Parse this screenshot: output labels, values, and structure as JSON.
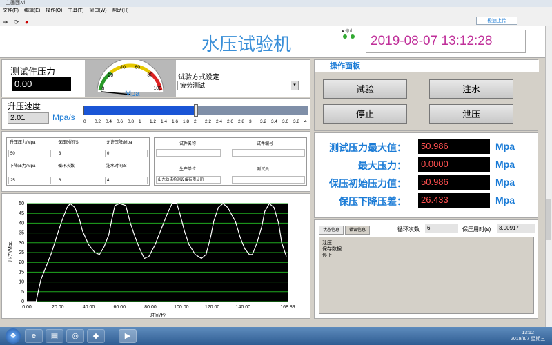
{
  "window": {
    "title": "主画面.vi"
  },
  "menu": [
    "文件(F)",
    "编辑(E)",
    "操作(O)",
    "工具(T)",
    "窗口(W)",
    "帮助(H)"
  ],
  "upload_label": "极速上传",
  "header": {
    "title": "水压试验机",
    "datetime": "2019-08-07 13:12:28",
    "light_label": "● 停止"
  },
  "pressure": {
    "label": "测试件压力",
    "value": "0.00",
    "gauge_unit": "Mpa",
    "gauge_ticks": [
      "0",
      "20",
      "40",
      "60",
      "80",
      "100"
    ],
    "gauge_value": 0
  },
  "test_mode": {
    "label": "试验方式设定",
    "value": "疲劳测试"
  },
  "rate": {
    "label": "升压速度",
    "value": "2.01",
    "unit": "Mpa/s",
    "slider_fraction": 0.5,
    "ticks": [
      "0",
      "0.2",
      "0.4",
      "0.6",
      "0.8",
      "1",
      "1.2",
      "1.4",
      "1.6",
      "1.8",
      "2",
      "2.2",
      "2.4",
      "2.6",
      "2.8",
      "3",
      "3.2",
      "3.4",
      "3.6",
      "3.8",
      "4"
    ]
  },
  "params": {
    "h1": "升压压力/Mpa",
    "h2": "保压时间/S",
    "h3": "允许压降/Mpa",
    "v1": "50",
    "v2": "3",
    "v3": "0",
    "h4": "下降压力/Mpa",
    "h5": "循环次数",
    "h6": "注水时间/S",
    "v4": "25",
    "v5": "6",
    "v6": "4"
  },
  "info": {
    "name_label": "试件名称",
    "code_label": "试件编号",
    "maker_label": "生产单位",
    "tester_label": "测试员",
    "maker_value": "山东玖诺检测设备有限公司"
  },
  "control_panel": {
    "title": "操作面板",
    "btn_test": "试验",
    "btn_fill": "注水",
    "btn_stop": "停止",
    "btn_release": "泄压"
  },
  "stats": [
    {
      "label": "测试压力最大值：",
      "value": "50.986",
      "unit": "Mpa"
    },
    {
      "label": "最大压力：",
      "value": "0.0000",
      "unit": "Mpa"
    },
    {
      "label": "保压初始压力值：",
      "value": "50.986",
      "unit": "Mpa"
    },
    {
      "label": "保压下降压差：",
      "value": "26.433",
      "unit": "Mpa"
    }
  ],
  "status": {
    "tab1": "状态信息",
    "tab2": "错误信息",
    "cycle_label": "循环次数",
    "cycle_value": "6",
    "time_label": "保压用时(s)",
    "time_value": "3.00917",
    "log": [
      "泄压",
      "保存数据",
      "停止"
    ]
  },
  "chart_data": {
    "type": "line",
    "ylabel": "压力/Mpa",
    "xlabel": "时间/秒",
    "xlim": [
      0,
      168.89
    ],
    "ylim": [
      0,
      50
    ],
    "xticks": [
      "0.00",
      "20.00",
      "40.00",
      "60.00",
      "80.00",
      "100.00",
      "120.00",
      "140.00",
      "168.89"
    ],
    "yticks": [
      "0",
      "5",
      "10",
      "15",
      "20",
      "25",
      "30",
      "35",
      "40",
      "45",
      "50"
    ],
    "series": [
      {
        "x": [
          0,
          6,
          7,
          9,
          11,
          13,
          16,
          18,
          20,
          23,
          26,
          28,
          31,
          34,
          36,
          40,
          44,
          47,
          50,
          53,
          55,
          57,
          60,
          64,
          67,
          70,
          73,
          76,
          79,
          83,
          87,
          91,
          94,
          97,
          99,
          102,
          105,
          109,
          113,
          116,
          119,
          121,
          124,
          127,
          130,
          135,
          138,
          141,
          144,
          146,
          149,
          152,
          154,
          157,
          160,
          163,
          165,
          168
        ],
        "y": [
          0,
          0,
          4,
          11,
          15,
          19,
          25,
          30,
          35,
          42,
          48,
          50,
          48,
          42,
          36,
          29,
          25,
          24,
          28,
          34,
          42,
          49,
          50,
          49,
          40,
          33,
          27,
          22,
          23,
          29,
          37,
          45,
          50,
          50,
          45,
          36,
          29,
          24,
          22,
          24,
          33,
          41,
          48,
          50,
          48,
          41,
          33,
          27,
          24,
          24,
          30,
          38,
          46,
          50,
          48,
          40,
          30,
          23
        ]
      }
    ]
  }
}
